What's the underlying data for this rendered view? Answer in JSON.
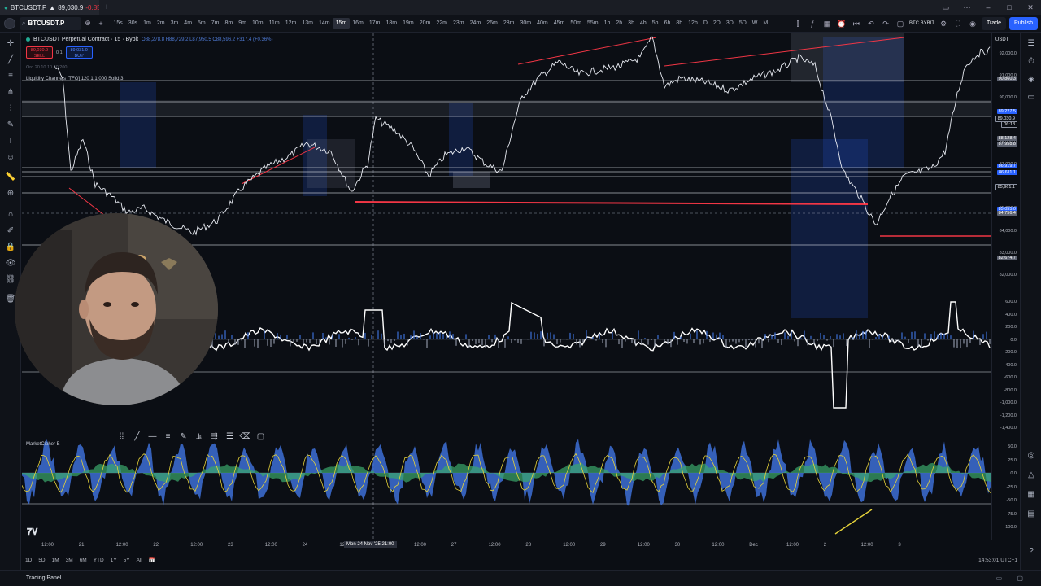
{
  "window": {
    "tab_symbol": "BTCUSDT.P",
    "tab_price": "89,030.9",
    "tab_change": "-0.85%"
  },
  "toolbar": {
    "symbol": "BTCUSDT.P",
    "intervals": [
      "15s",
      "30s",
      "1m",
      "2m",
      "3m",
      "4m",
      "5m",
      "7m",
      "8m",
      "9m",
      "10m",
      "11m",
      "12m",
      "13m",
      "14m",
      "15m",
      "16m",
      "17m",
      "18m",
      "19m",
      "20m",
      "22m",
      "23m",
      "24m",
      "26m",
      "28m",
      "30m",
      "40m",
      "45m",
      "50m",
      "55m",
      "1h",
      "2h",
      "3h",
      "4h",
      "5h",
      "6h",
      "8h",
      "12h",
      "D",
      "2D",
      "3D",
      "5D",
      "W",
      "M"
    ],
    "active_interval": "15m",
    "exchange_line1": "BTC BYBIT",
    "trade_label": "Trade",
    "publish_label": "Publish"
  },
  "legend": {
    "title": "BTCUSDT Perpetual Contract · 15 · Bybit",
    "ohlc": "O88,278.8 H88,729.2 L87,950.5 C88,596.2 +317.4 (+0.36%)",
    "sell_price": "89,030.9",
    "sell_label": "SELL",
    "spread": "0.1",
    "buy_price": "89,031.0",
    "buy_label": "BUY",
    "hidden_indicator": "Ord 20 10 10 50 200 ",
    "indicator1": "Liquidity Channels [TFO] 120 1 1,000 Solid 3",
    "indicator3": "MarketCipher B"
  },
  "price_scale": {
    "currency": "USDT",
    "ticks": [
      "92,000.0",
      "91,000.0",
      "90,000.0",
      "89,000.0",
      "88,000.0",
      "87,000.0",
      "86,000.0",
      "85,000.0",
      "84,000.0",
      "83,000.0",
      "82,000.0"
    ],
    "badges": [
      {
        "text": "90,860.3",
        "color": "#5d6270"
      },
      {
        "text": "89,227.5",
        "color": "#2962ff"
      },
      {
        "text": "89,030.9",
        "color": "#ffffff"
      },
      {
        "text": "06:18",
        "color": "#ffffff"
      },
      {
        "text": "88,128.4",
        "color": "#5d6270"
      },
      {
        "text": "87,958.8",
        "color": "#5d6270"
      },
      {
        "text": "86,919.7",
        "color": "#2962ff"
      },
      {
        "text": "86,611.1",
        "color": "#2962ff"
      },
      {
        "text": "85,961.1",
        "color": "#ffffff"
      },
      {
        "text": "85,055.0",
        "color": "#2962ff"
      },
      {
        "text": "84,756.4",
        "color": "#5d6270"
      },
      {
        "text": "82,674.7",
        "color": "#5d6270"
      }
    ],
    "osc_ticks": [
      "600.0",
      "400.0",
      "200.0",
      "0.0",
      "-200.0",
      "-400.0",
      "-600.0",
      "-800.0",
      "-1,000.0",
      "-1,200.0",
      "-1,400.0"
    ],
    "mc_ticks": [
      "50.0",
      "25.0",
      "0.0",
      "-25.0",
      "-50.0",
      "-75.0",
      "-100.0"
    ]
  },
  "time_axis": {
    "ticks": [
      "12:00",
      "21",
      "12:00",
      "22",
      "12:00",
      "23",
      "12:00",
      "24",
      "12",
      "26",
      "12:00",
      "27",
      "12:00",
      "28",
      "12:00",
      "29",
      "12:00",
      "30",
      "12:00",
      "Dec",
      "12:00",
      "2",
      "12:00",
      "3"
    ],
    "cursor_label": "Mon 24 Nov '25  21:00"
  },
  "bottom": {
    "ranges": [
      "1D",
      "5D",
      "1M",
      "3M",
      "6M",
      "YTD",
      "1Y",
      "5Y",
      "All"
    ],
    "clock": "14:53:01 UTC+1",
    "trading_panel": "Trading Panel"
  },
  "colors": {
    "accent": "#2962ff",
    "down": "#f23645",
    "up": "#22ab94",
    "oscillator_line": "#ffffff",
    "mc_wave": "#3d6fd6",
    "mc_money_flow": "#3aa86b",
    "mc_signal": "#e6d33a"
  }
}
